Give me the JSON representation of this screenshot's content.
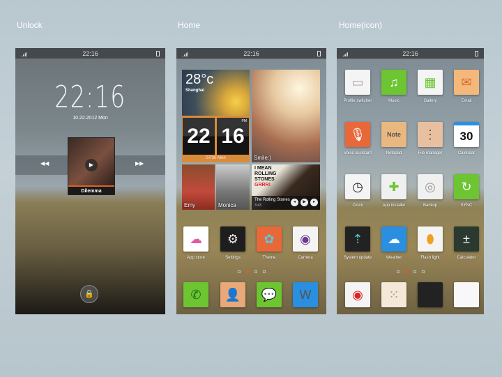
{
  "titles": {
    "unlock": "Unlock",
    "home": "Home",
    "home_icon": "Home(icon)"
  },
  "status_time": "22:16",
  "unlock": {
    "time": "22:16",
    "date": "10.22.2012 Mon",
    "song": "Dilemma",
    "prev_icon": "rewind-icon",
    "next_icon": "fast-forward-icon",
    "lock_icon": "lock-icon"
  },
  "home": {
    "weather": {
      "temp": "28°c",
      "city": "Shanghai"
    },
    "clock": {
      "hours": "22",
      "minutes": "16",
      "ampm": "PM",
      "date": "07/30 Mon"
    },
    "photo_label": "Smile:)",
    "contacts": [
      "Emy",
      "Monica"
    ],
    "music": {
      "art_line1": "I MEAN",
      "art_line2": "ROLLING",
      "art_line3": "STONES",
      "art_line4": "GRRR!",
      "artist": "The Rolling Stones",
      "time": "3:43"
    },
    "apps": [
      {
        "label": "App store",
        "color": "#ffffff",
        "glyph": "☁",
        "fg": "#e05aa0",
        "icon": "shopping-bag-icon"
      },
      {
        "label": "Settings",
        "color": "#1e1e1e",
        "glyph": "⚙",
        "fg": "#eee",
        "icon": "gear-icon"
      },
      {
        "label": "Theme",
        "color": "#e8683a",
        "glyph": "✿",
        "fg": "#5cd",
        "icon": "theme-icon"
      },
      {
        "label": "Camera",
        "color": "#f4f4f4",
        "glyph": "◉",
        "fg": "#6a3a90",
        "icon": "camera-icon"
      }
    ],
    "dock": [
      {
        "label": "",
        "color": "#6cc531",
        "glyph": "✆",
        "fg": "#1d6a1d",
        "icon": "phone-icon"
      },
      {
        "label": "",
        "color": "#e8a87a",
        "glyph": "👤",
        "fg": "#6a3a20",
        "icon": "contacts-icon"
      },
      {
        "label": "",
        "color": "#6cc531",
        "glyph": "💬",
        "fg": "#fff",
        "icon": "messages-icon"
      },
      {
        "label": "",
        "color": "#2a8fe0",
        "glyph": "W",
        "fg": "#555",
        "icon": "browser-icon"
      }
    ]
  },
  "home_icon": {
    "rows": [
      [
        {
          "label": "Profile switcher",
          "color": "#f4f4f4",
          "glyph": "▭",
          "fg": "#aaa",
          "icon": "profile-switcher-icon"
        },
        {
          "label": "Music",
          "color": "#6cc531",
          "glyph": "♫",
          "fg": "#fff",
          "icon": "music-icon"
        },
        {
          "label": "Gallery",
          "color": "#f4f4f4",
          "glyph": "▦",
          "fg": "#6cc531",
          "icon": "gallery-icon"
        },
        {
          "label": "Email",
          "color": "#f4b87a",
          "glyph": "✉",
          "fg": "#d86a30",
          "icon": "email-icon"
        }
      ],
      [
        {
          "label": "Voice assistant",
          "color": "#e8683a",
          "glyph": "🎙",
          "fg": "#fff",
          "icon": "microphone-icon"
        },
        {
          "label": "Notepad",
          "color": "#e8b880",
          "glyph": "Note",
          "fg": "#555",
          "icon": "notepad-icon"
        },
        {
          "label": "File manager",
          "color": "#e8c0a0",
          "glyph": "⋮",
          "fg": "#555",
          "icon": "file-manager-icon"
        },
        {
          "label": "Calendar",
          "color": "#ffffff",
          "glyph": "30",
          "fg": "#111",
          "icon": "calendar-icon"
        }
      ],
      [
        {
          "label": "Clock",
          "color": "#f4f4f4",
          "glyph": "◷",
          "fg": "#222",
          "icon": "clock-icon"
        },
        {
          "label": "App installer",
          "color": "#f0f0f0",
          "glyph": "✚",
          "fg": "#6cc531",
          "icon": "puzzle-icon"
        },
        {
          "label": "Backup",
          "color": "#f0f0f0",
          "glyph": "◎",
          "fg": "#999",
          "icon": "backup-icon"
        },
        {
          "label": "SYNC",
          "color": "#6cc531",
          "glyph": "↻",
          "fg": "#fff",
          "icon": "sync-icon"
        }
      ],
      [
        {
          "label": "System update",
          "color": "#222",
          "glyph": "⇡",
          "fg": "#5cc",
          "icon": "system-update-icon"
        },
        {
          "label": "Weather",
          "color": "#2a8fe0",
          "glyph": "☁",
          "fg": "#fff",
          "icon": "weather-icon"
        },
        {
          "label": "Flash light",
          "color": "#f4f4f4",
          "glyph": "⬮",
          "fg": "#f0a020",
          "icon": "flashlight-icon"
        },
        {
          "label": "Calculator",
          "color": "#2a3a30",
          "glyph": "±",
          "fg": "#fff",
          "icon": "calculator-icon"
        }
      ],
      [
        {
          "label": "",
          "color": "#f4f4f4",
          "glyph": "◉",
          "fg": "#d22",
          "icon": "record-icon"
        },
        {
          "label": "",
          "color": "#f4e8d8",
          "glyph": "⁙",
          "fg": "#999",
          "icon": "dialpad-icon"
        },
        {
          "label": "",
          "color": "#222",
          "glyph": "",
          "fg": "#fff",
          "icon": "blank-dark-icon"
        },
        {
          "label": "",
          "color": "#f8f8f8",
          "glyph": "",
          "fg": "#fff",
          "icon": "blank-light-icon"
        }
      ]
    ]
  }
}
